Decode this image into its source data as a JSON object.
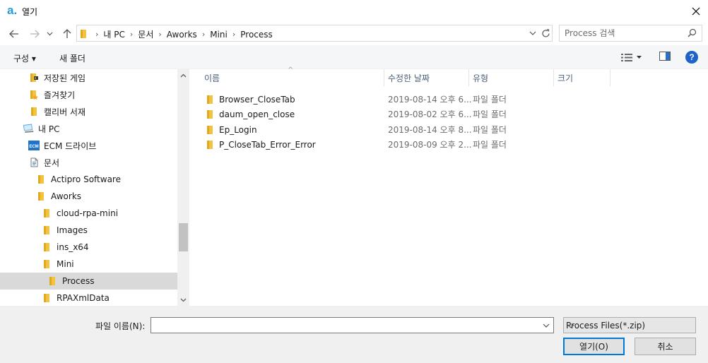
{
  "window": {
    "app_logo": "a.",
    "title": "열기"
  },
  "address": {
    "breadcrumbs": [
      "내 PC",
      "문서",
      "Aworks",
      "Mini",
      "Process"
    ],
    "search_placeholder": "Process 검색"
  },
  "toolbar": {
    "organize_label": "구성 ▾",
    "new_folder_label": "새 폴더"
  },
  "nav": {
    "items": [
      {
        "label": "저장된 게임",
        "icon": "saved-games-icon",
        "indent": 1
      },
      {
        "label": "즐겨찾기",
        "icon": "favorites-folder-icon",
        "indent": 1
      },
      {
        "label": "캘리버 서재",
        "icon": "folder-icon",
        "indent": 1
      },
      {
        "label": "내 PC",
        "icon": "pc-icon",
        "indent": 0
      },
      {
        "label": "ECM 드라이브",
        "icon": "ecm-drive-icon",
        "indent": 1
      },
      {
        "label": "문서",
        "icon": "documents-icon",
        "indent": 1
      },
      {
        "label": "Actipro Software",
        "icon": "folder-icon",
        "indent": 2
      },
      {
        "label": "Aworks",
        "icon": "folder-icon",
        "indent": 2
      },
      {
        "label": "cloud-rpa-mini",
        "icon": "folder-icon",
        "indent": 3
      },
      {
        "label": "Images",
        "icon": "folder-icon",
        "indent": 3
      },
      {
        "label": "ins_x64",
        "icon": "folder-icon",
        "indent": 3
      },
      {
        "label": "Mini",
        "icon": "folder-icon",
        "indent": 3
      },
      {
        "label": "Process",
        "icon": "folder-icon",
        "indent": 4,
        "selected": true
      },
      {
        "label": "RPAXmlData",
        "icon": "folder-icon",
        "indent": 3
      }
    ]
  },
  "files": {
    "columns": [
      "이름",
      "수정한 날짜",
      "유형",
      "크기"
    ],
    "rows": [
      {
        "name": "Browser_CloseTab",
        "date": "2019-08-14 오후 6...",
        "type": "파일 폴더"
      },
      {
        "name": "daum_open_close",
        "date": "2019-08-02 오후 6...",
        "type": "파일 폴더"
      },
      {
        "name": "Ep_Login",
        "date": "2019-08-14 오후 8...",
        "type": "파일 폴더"
      },
      {
        "name": "P_CloseTab_Error_Error",
        "date": "2019-08-09 오후 2...",
        "type": "파일 폴더"
      }
    ]
  },
  "bottom": {
    "filename_label": "파일 이름(N):",
    "filename_value": "",
    "filetype_value": "Process Files(*.zip)",
    "open_label": "열기(O)",
    "cancel_label": "취소"
  },
  "colors": {
    "accent": "#0078d7",
    "folder": "#f0c342",
    "logo": "#2b9bd6",
    "help": "#1e64c8"
  }
}
